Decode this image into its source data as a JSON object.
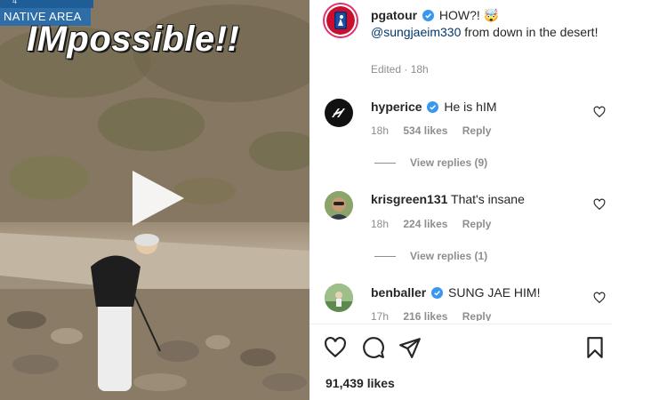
{
  "video": {
    "overlay_text": "IMpossible!!",
    "native_area_label": "NATIVE AREA",
    "native_area_top": "4"
  },
  "post": {
    "username": "pgatour",
    "caption_text": "HOW?! 🤯",
    "mention": "@sungjaeim330",
    "caption_rest": " from down in the desert!",
    "edited": "Edited",
    "time": "18h"
  },
  "comments": [
    {
      "username": "hyperice",
      "text": "He is hIM",
      "time": "18h",
      "likes": "534 likes",
      "reply": "Reply",
      "view_replies": "View replies (9)",
      "verified": true
    },
    {
      "username": "krisgreen131",
      "text": "That's insane",
      "time": "18h",
      "likes": "224 likes",
      "reply": "Reply",
      "view_replies": "View replies (1)",
      "verified": false
    },
    {
      "username": "benballer",
      "text": "SUNG JAE HIM!",
      "time": "17h",
      "likes": "216 likes",
      "reply": "Reply",
      "verified": true
    }
  ],
  "footer": {
    "likes": "91,439 likes",
    "actions": [
      "heart-icon",
      "comment-icon",
      "share-icon",
      "bookmark-icon"
    ]
  },
  "colors": {
    "verified": "#3897f0",
    "mention": "#00376b",
    "muted": "#8e8e8e",
    "native_tag": "#2d6ea8"
  }
}
